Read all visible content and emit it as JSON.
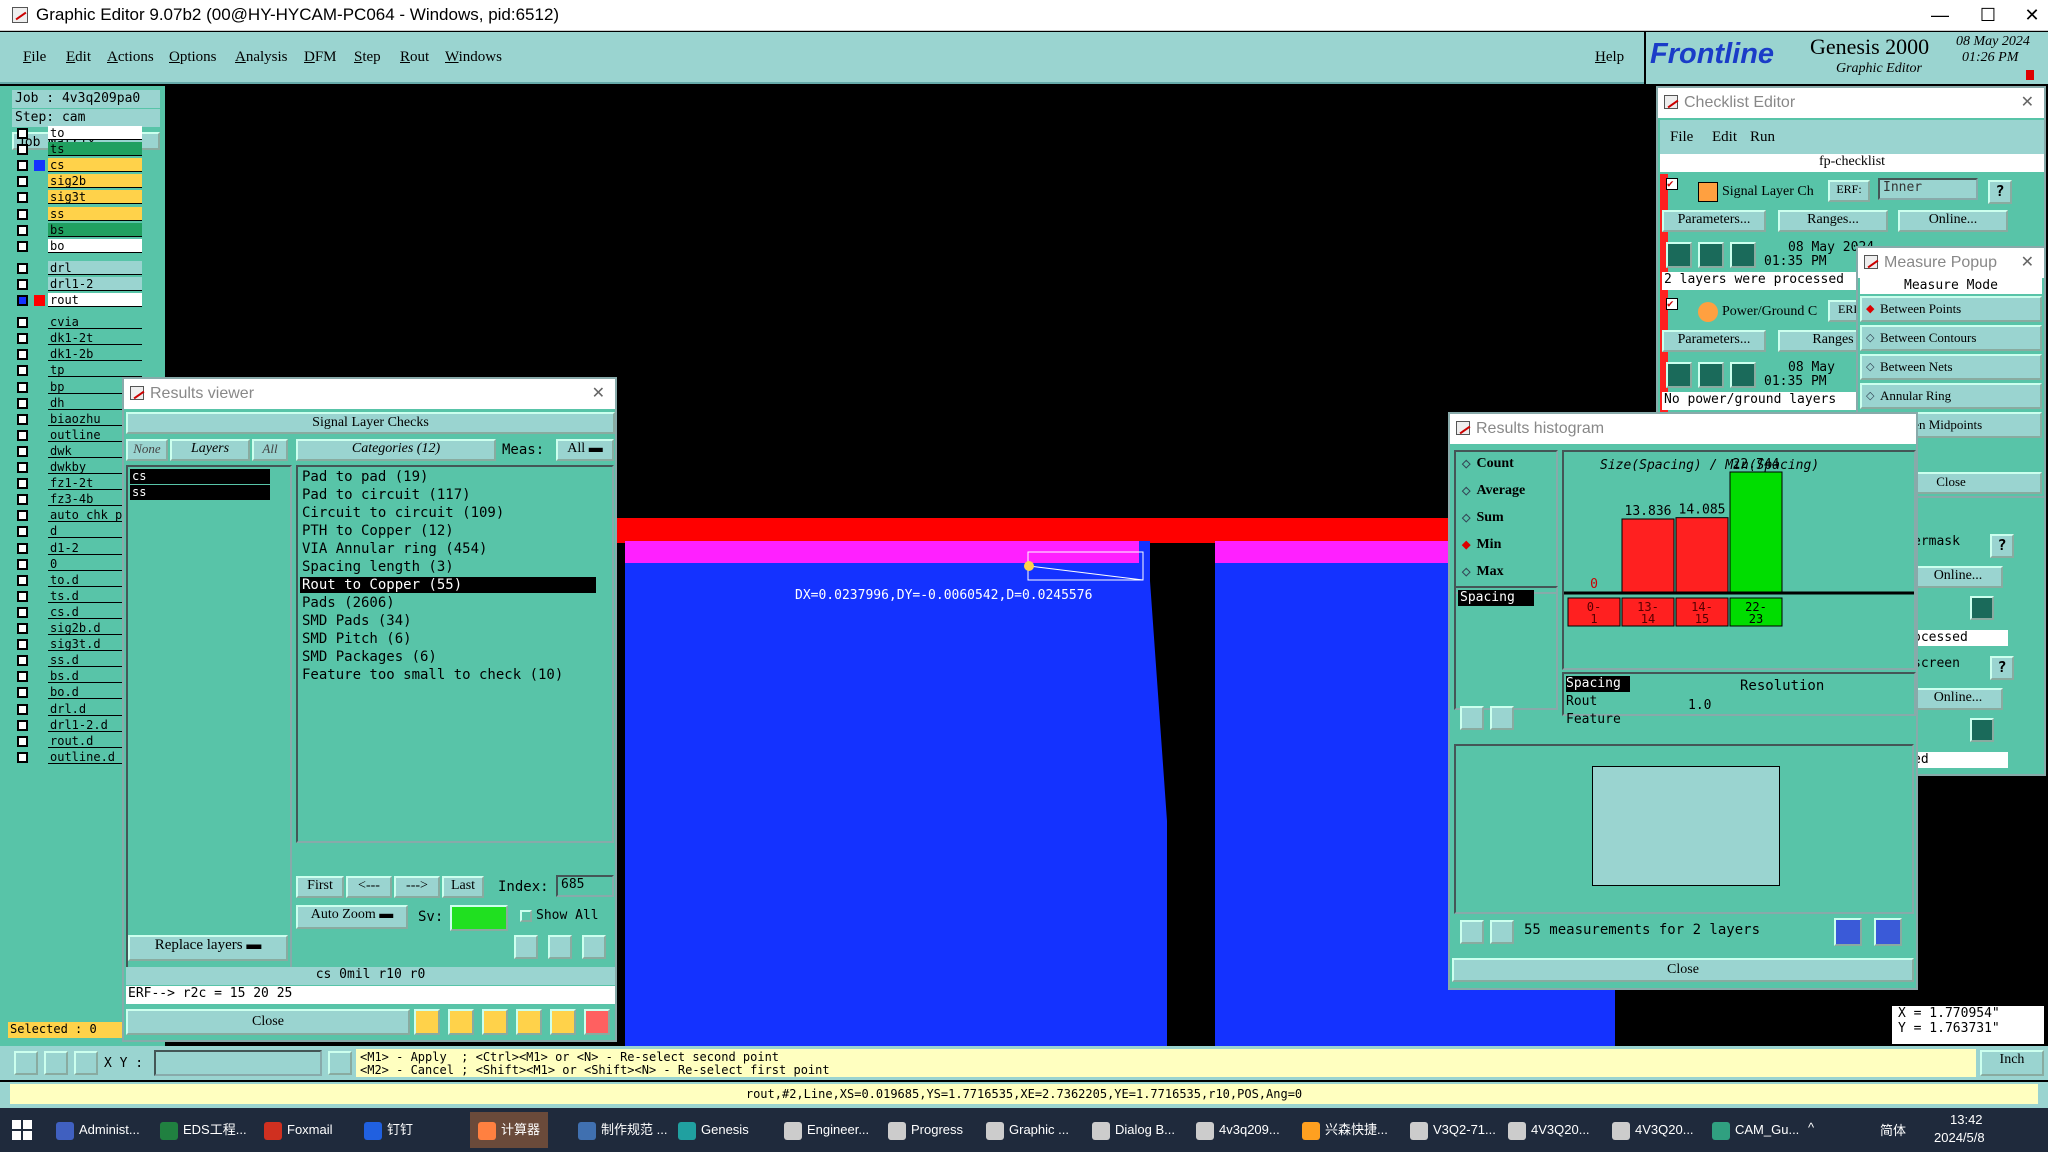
{
  "window": {
    "title": "Graphic Editor 9.07b2 (00@HY-HYCAM-PC064 - Windows, pid:6512)"
  },
  "menubar": {
    "items": [
      "File",
      "Edit",
      "Actions",
      "Options",
      "Analysis",
      "DFM",
      "Step",
      "Rout",
      "Windows"
    ],
    "help": "Help"
  },
  "brand": {
    "logo": "Frontline",
    "product": "Genesis 2000",
    "sub": "Graphic Editor",
    "date": "08 May 2024",
    "time": "01:26 PM"
  },
  "job": {
    "job": "Job : 4v3q209pa0",
    "step": "Step: cam",
    "matrix": "Job Matrix ..."
  },
  "layers": [
    "to",
    "ts",
    "cs",
    "sig2b",
    "sig3t",
    "ss",
    "bs",
    "bo",
    "drl",
    "drl1-2",
    "rout",
    "cvia",
    "dk1-2t",
    "dk1-2b",
    "tp",
    "bp",
    "dh",
    "biaozhu",
    "outline",
    "dwk",
    "dwkby",
    "fz1-2t",
    "fz3-4b",
    "auto_chk_p",
    "d",
    "d1-2",
    "0",
    "to.d",
    "ts.d",
    "cs.d",
    "sig2b.d",
    "sig3t.d",
    "ss.d",
    "bs.d",
    "bo.d",
    "drl.d",
    "drl1-2.d",
    "rout.d",
    "outline.d"
  ],
  "selected": "Selected : 0",
  "canvas": {
    "measure": "DX=0.0237996,DY=-0.0060542,D=0.0245576"
  },
  "coords": {
    "x": "X  = 1.770954\"",
    "y": "Y  = 1.763731\""
  },
  "results_viewer": {
    "title": "Results viewer",
    "header": "Signal Layer Checks",
    "none": "None",
    "layers_btn": "Layers",
    "all": "All",
    "layer_items": [
      "cs",
      "ss"
    ],
    "categories_btn": "Categories (12)",
    "meas_label": "Meas:",
    "meas_value": "All",
    "categories": [
      "Pad to pad (19)",
      "Pad to circuit (117)",
      "Circuit to circuit (109)",
      "PTH to Copper (12)",
      "VIA Annular ring (454)",
      "Spacing length (3)",
      "Rout to Copper (55)",
      "Pads (2606)",
      "SMD Pads (34)",
      "SMD Pitch (6)",
      "SMD Packages (6)",
      "Feature too small to check (10)"
    ],
    "selected_category": "Rout to Copper (55)",
    "first": "First",
    "prev": "<---",
    "next": "--->",
    "last": "Last",
    "index_label": "Index:",
    "index_value": "685",
    "auto_zoom": "Auto Zoom",
    "sv_label": "Sv:",
    "show_all": "Show All",
    "replace": "Replace layers",
    "info": "cs  0mil   r10   r0",
    "erf": "ERF--> r2c = 15 20 25",
    "close": "Close"
  },
  "checklist": {
    "title": "Checklist Editor",
    "menu": [
      "File",
      "Edit",
      "Run"
    ],
    "name": "fp-checklist",
    "row1": {
      "label": "Signal Layer Ch",
      "erf": "ERF:",
      "value": "Inner",
      "params": "Parameters...",
      "ranges": "Ranges...",
      "online": "Online...",
      "date": "08 May 2024",
      "time": "01:35 PM",
      "msg": "2 layers were processed"
    },
    "row2": {
      "label": "Power/Ground C",
      "erf": "ERF",
      "params": "Parameters...",
      "ranges": "Ranges",
      "date": "08 May",
      "time": "01:35 PM",
      "msg": "No power/ground layers"
    },
    "side": [
      "ermask",
      "Online...",
      "ocessed",
      "screen",
      "Online...",
      "ed"
    ]
  },
  "measure_popup": {
    "title": "Measure Popup",
    "mode": "Measure Mode",
    "options": [
      "Between Points",
      "Between Contours",
      "Between Nets",
      "Annular Ring",
      "Between Midpoints"
    ],
    "selected": "Between Points",
    "close": "Close"
  },
  "histogram": {
    "title": "Results histogram",
    "stats": [
      "Count",
      "Average",
      "Sum",
      "Min",
      "Max"
    ],
    "selected_stat": "Min",
    "spacing": "Spacing",
    "chart_title": "Size(Spacing) / Min(Spacing)",
    "resolution": "Resolution",
    "resolution_value": "1.0",
    "attrs": [
      "Spacing",
      "Rout",
      "Feature"
    ],
    "summary": "55 measurements for 2 layers",
    "close": "Close"
  },
  "chart_data": {
    "type": "bar",
    "categories": [
      "0-1",
      "13-14",
      "14-15",
      "22-23"
    ],
    "values": [
      0,
      13.836,
      14.085,
      22.744
    ],
    "data_labels": [
      "0",
      "13.836",
      "14.085",
      "22.744"
    ],
    "title": "Size(Spacing) / Min(Spacing)",
    "colors": [
      "#ff2020",
      "#ff2020",
      "#ff2020",
      "#00dd00"
    ]
  },
  "statusbar": {
    "xy_label": "X Y :",
    "help1": "<M1> - Apply  ; <Ctrl><M1> or <N> - Re-select second point",
    "help2": "<M2> - Cancel ; <Shift><M1> or <Shift><N> - Re-select first point",
    "units": "Inch",
    "feature": "rout,#2,Line,XS=0.019685,YS=1.7716535,XE=2.7362205,YE=1.7716535,r10,POS,Ang=0"
  },
  "taskbar": {
    "items": [
      "Administ...",
      "EDS工程...",
      "Foxmail",
      "钉钉",
      "计算器",
      "制作规范 ...",
      "Genesis",
      "Engineer...",
      "Progress",
      "Graphic ...",
      "Dialog B...",
      "4v3q209...",
      "兴森快捷...",
      "V3Q2-71...",
      "4V3Q20...",
      "4V3Q20...",
      "CAM_Gu..."
    ],
    "ime": "简体",
    "time": "13:42",
    "date": "2024/5/8"
  }
}
